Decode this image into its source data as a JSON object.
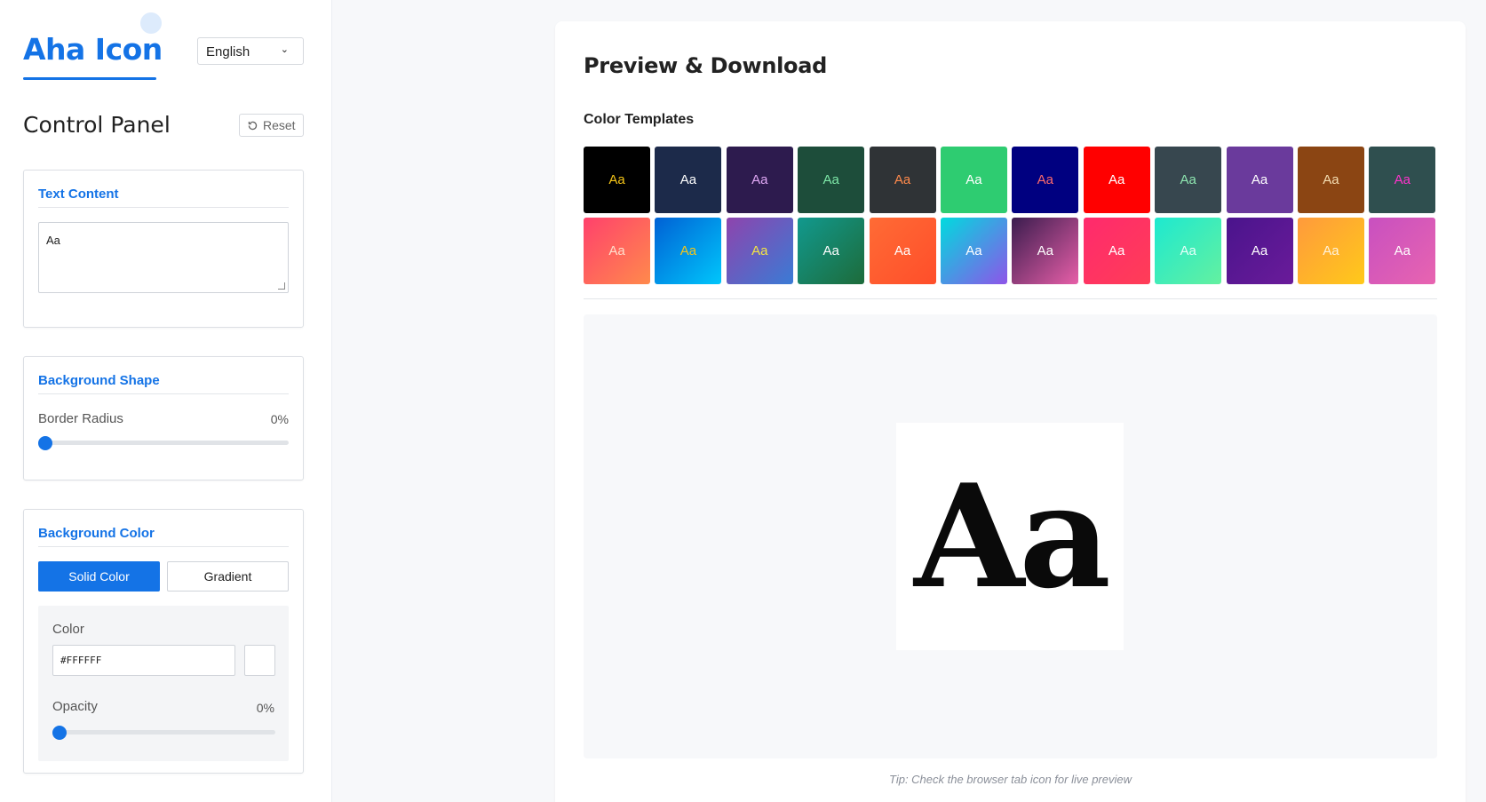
{
  "header": {
    "logo": "Aha Icon",
    "language": "English"
  },
  "control_panel": {
    "title": "Control Panel",
    "reset_label": "Reset"
  },
  "text_content": {
    "title": "Text Content",
    "value": "Aa"
  },
  "background_shape": {
    "title": "Background Shape",
    "border_radius_label": "Border Radius",
    "border_radius_value": "0%",
    "border_radius_level": 0
  },
  "background_color": {
    "title": "Background Color",
    "solid_label": "Solid Color",
    "gradient_label": "Gradient",
    "color_label": "Color",
    "color_value": "#FFFFFF",
    "opacity_label": "Opacity",
    "opacity_value": "0%",
    "opacity_level": 0
  },
  "preview": {
    "title": "Preview & Download",
    "templates_title": "Color Templates",
    "icon_text": "Aa",
    "tip": "Tip: Check the browser tab icon for live preview"
  },
  "templates": [
    {
      "label": "Aa",
      "bg": "#000000",
      "fg": "#f5c518"
    },
    {
      "label": "Aa",
      "bg": "#1c2a4a",
      "fg": "#ffffff"
    },
    {
      "label": "Aa",
      "bg": "#2d1b4e",
      "fg": "#e0a8f5"
    },
    {
      "label": "Aa",
      "bg": "#1d4d3a",
      "fg": "#7ee8a8"
    },
    {
      "label": "Aa",
      "bg": "#2f3336",
      "fg": "#ff8a4c"
    },
    {
      "label": "Aa",
      "bg": "#2ecc71",
      "fg": "#ffffff"
    },
    {
      "label": "Aa",
      "bg": "#000080",
      "fg": "#ff6b6b"
    },
    {
      "label": "Aa",
      "bg": "#ff0000",
      "fg": "#ffffff"
    },
    {
      "label": "Aa",
      "bg": "#37474f",
      "fg": "#8ee6b0"
    },
    {
      "label": "Aa",
      "bg": "#6a3a9c",
      "fg": "#ffffff"
    },
    {
      "label": "Aa",
      "bg": "#8b4513",
      "fg": "#f5deb3"
    },
    {
      "label": "Aa",
      "bg": "#2f4f4f",
      "fg": "#ff33cc"
    },
    {
      "label": "Aa",
      "bg": "linear-gradient(135deg,#ff416c,#ff8a4c)",
      "fg": "#ffe0cc"
    },
    {
      "label": "Aa",
      "bg": "linear-gradient(135deg,#0061d5,#00c6fb)",
      "fg": "#f5c518"
    },
    {
      "label": "Aa",
      "bg": "linear-gradient(135deg,#8e44ad,#3a7bd5)",
      "fg": "#f5e642"
    },
    {
      "label": "Aa",
      "bg": "linear-gradient(135deg,#11998e,#1d6b3a)",
      "fg": "#ffffff"
    },
    {
      "label": "Aa",
      "bg": "linear-gradient(135deg,#ff6b35,#ff4e2a)",
      "fg": "#ffffff"
    },
    {
      "label": "Aa",
      "bg": "linear-gradient(135deg,#00dbde,#8e54e9)",
      "fg": "#ffffff"
    },
    {
      "label": "Aa",
      "bg": "linear-gradient(135deg,#3a1c4e,#e75fa8)",
      "fg": "#ffffff"
    },
    {
      "label": "Aa",
      "bg": "linear-gradient(135deg,#ff2a6d,#ff3d57)",
      "fg": "#ffffff"
    },
    {
      "label": "Aa",
      "bg": "linear-gradient(135deg,#1de9d0,#64f0a0)",
      "fg": "#e6fff9"
    },
    {
      "label": "Aa",
      "bg": "linear-gradient(135deg,#4a148c,#6a1b9a)",
      "fg": "#ffffff"
    },
    {
      "label": "Aa",
      "bg": "linear-gradient(135deg,#ff9a3c,#ffc91a)",
      "fg": "#fff2dc"
    },
    {
      "label": "Aa",
      "bg": "linear-gradient(135deg,#c850c0,#e864b0)",
      "fg": "#ffffff"
    }
  ],
  "colors": {
    "accent": "#1473e6"
  }
}
